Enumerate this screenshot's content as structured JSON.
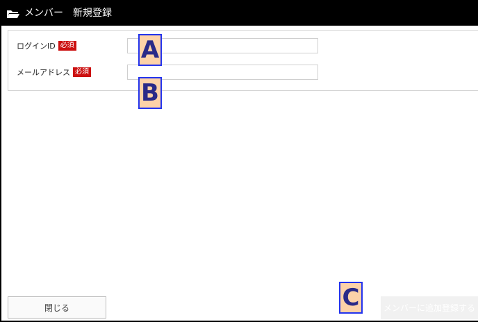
{
  "window": {
    "title": "メンバー　新規登録",
    "title_icon": "folder-open-icon"
  },
  "form": {
    "login_id": {
      "label": "ログインID",
      "required_badge": "必須",
      "value": "",
      "placeholder": ""
    },
    "email": {
      "label": "メールアドレス",
      "required_badge": "必須",
      "value": "",
      "placeholder": ""
    }
  },
  "markers": {
    "a": "A",
    "b": "B",
    "c": "C"
  },
  "footer": {
    "close_label": "閉じる",
    "add_label": "メンバーに追加登録する"
  },
  "colors": {
    "titlebar_bg": "#000000",
    "required_badge_bg": "#cc1111",
    "marker_fill": "#fdd2a8",
    "marker_border": "#2233ee"
  }
}
